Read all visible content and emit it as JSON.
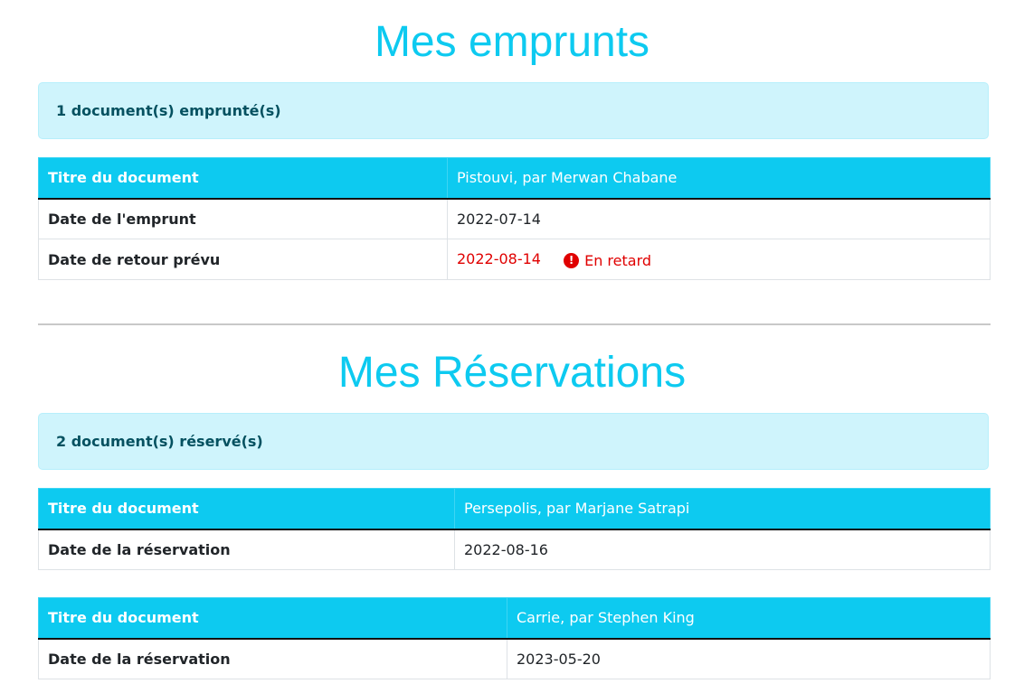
{
  "emprunts": {
    "title": "Mes emprunts",
    "alert": "1 document(s) emprunté(s)",
    "items": [
      {
        "title_label": "Titre du document",
        "title_value": "Pistouvi, par Merwan Chabane",
        "date_label": "Date de l'emprunt",
        "date_value": "2022-07-14",
        "return_label": "Date de retour prévu",
        "return_value": "2022-08-14",
        "late_label": "En retard",
        "late_icon": "!"
      }
    ]
  },
  "reservations": {
    "title": "Mes Réservations",
    "alert": "2 document(s) réservé(s)",
    "items": [
      {
        "title_label": "Titre du document",
        "title_value": "Persepolis, par Marjane Satrapi",
        "date_label": "Date de la réservation",
        "date_value": "2022-08-16"
      },
      {
        "title_label": "Titre du document",
        "title_value": "Carrie, par Stephen King",
        "date_label": "Date de la réservation",
        "date_value": "2023-05-20"
      }
    ]
  },
  "colors": {
    "accent": "#0dcaf0",
    "alert_bg": "#cff4fc",
    "alert_text": "#055160",
    "late": "#e00000"
  }
}
